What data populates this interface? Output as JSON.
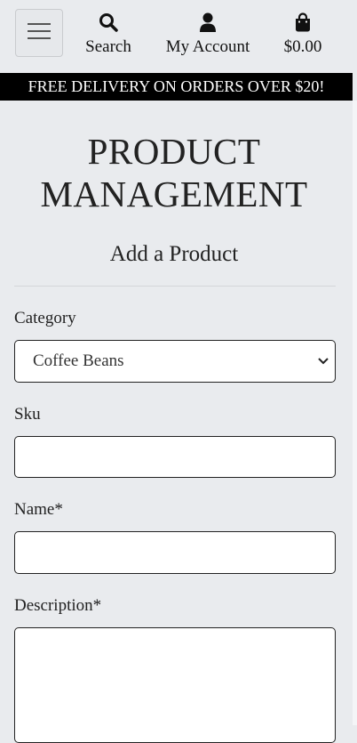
{
  "nav": {
    "search_label": "Search",
    "account_label": "My Account",
    "cart_total": "$0.00"
  },
  "banner": {
    "text": "FREE DELIVERY ON ORDERS OVER $20!"
  },
  "page": {
    "title_line1": "PRODUCT",
    "title_line2": "MANAGEMENT",
    "subtitle": "Add a Product"
  },
  "form": {
    "category": {
      "label": "Category",
      "selected": "Coffee Beans"
    },
    "sku": {
      "label": "Sku",
      "value": ""
    },
    "name": {
      "label": "Name*",
      "value": ""
    },
    "description": {
      "label": "Description*",
      "value": ""
    }
  },
  "icons": {
    "menu": "hamburger-icon",
    "search": "magnifier-icon",
    "account": "user-icon",
    "cart": "shopping-bag-icon",
    "select": "chevron-down-icon"
  }
}
